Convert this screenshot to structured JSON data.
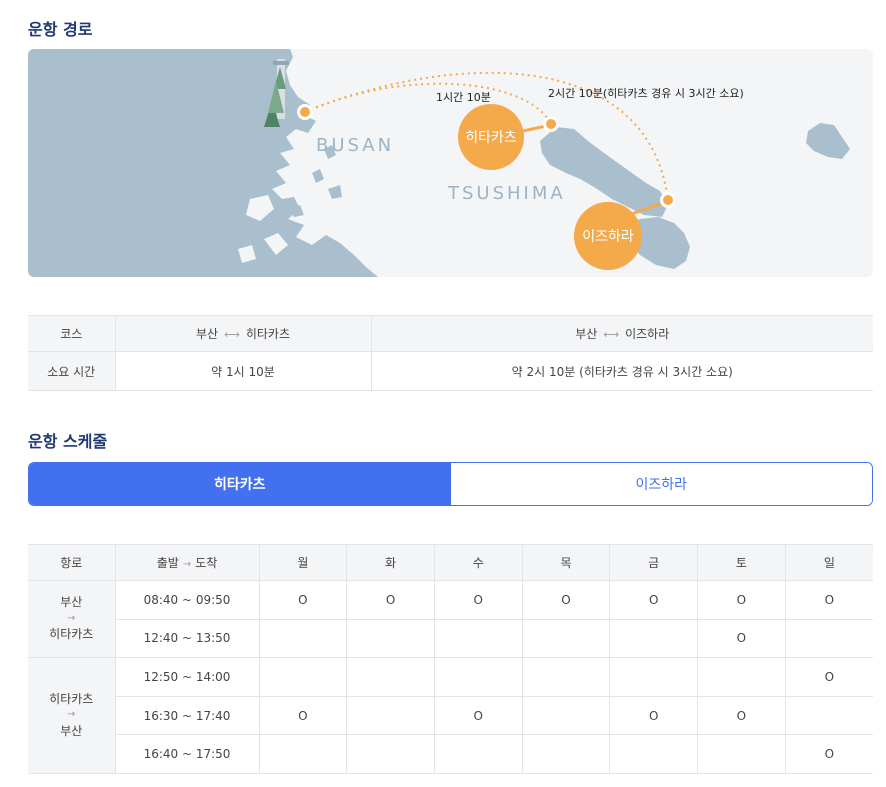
{
  "route_section": {
    "title": "운항 경로",
    "map": {
      "busan_label": "BUSAN",
      "tsushima_label": "TSUSHIMA",
      "hitakatsu_label": "히타카츠",
      "izuhara_label": "이즈하라",
      "duration_hitakatsu": "1시간 10분",
      "duration_izuhara": "2시간 10분(히타카츠 경유 시 3시간 소요)"
    }
  },
  "course_table": {
    "header": {
      "course": "코스",
      "route1_from": "부산",
      "route1_to": "히타카츠",
      "route2_from": "부산",
      "route2_to": "이즈하라"
    },
    "row": {
      "label": "소요 시간",
      "route1": "약 1시 10분",
      "route2": "약 2시 10분 (히타카츠 경유 시 3시간 소요)"
    }
  },
  "schedule_section": {
    "title": "운항 스케줄",
    "tabs": [
      {
        "label": "히타카츠"
      },
      {
        "label": "이즈하라"
      }
    ],
    "table": {
      "headers": {
        "route": "항로",
        "depart": "출발",
        "arrive": "도착",
        "days": [
          "월",
          "화",
          "수",
          "목",
          "금",
          "토",
          "일"
        ]
      },
      "groups": [
        {
          "from": "부산",
          "to": "히타카츠",
          "rows": [
            {
              "time": "08:40 ~ 09:50",
              "marks": [
                "O",
                "O",
                "O",
                "O",
                "O",
                "O",
                "O"
              ]
            },
            {
              "time": "12:40 ~ 13:50",
              "marks": [
                "",
                "",
                "",
                "",
                "",
                "O",
                ""
              ]
            }
          ]
        },
        {
          "from": "히타카츠",
          "to": "부산",
          "rows": [
            {
              "time": "12:50 ~ 14:00",
              "marks": [
                "",
                "",
                "",
                "",
                "",
                "",
                "O"
              ]
            },
            {
              "time": "16:30 ~ 17:40",
              "marks": [
                "O",
                "",
                "O",
                "",
                "O",
                "O",
                ""
              ]
            },
            {
              "time": "16:40 ~ 17:50",
              "marks": [
                "",
                "",
                "",
                "",
                "",
                "",
                "O"
              ]
            }
          ]
        }
      ]
    }
  },
  "colors": {
    "accent": "#4270ef",
    "title": "#1f3a73",
    "port": "#f4a94b",
    "land": "#a9bfcd"
  },
  "arrow_lr_glyph": "⟷",
  "arrow_r_glyph": "→"
}
